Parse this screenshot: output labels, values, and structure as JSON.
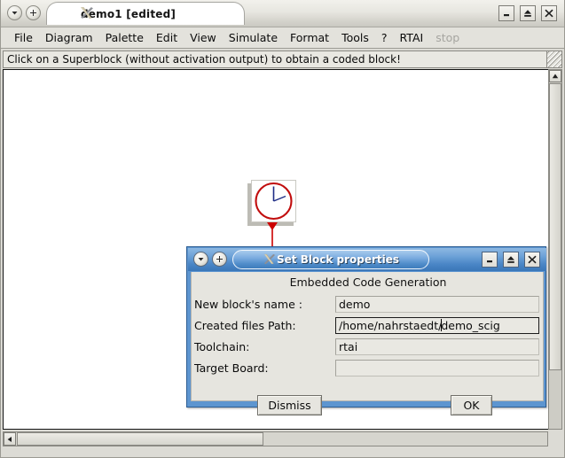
{
  "main_window": {
    "title": "demo1 [edited]",
    "app_icon": "scilab-x-icon",
    "titlebar_buttons": {
      "menu_label": "▼",
      "plus_label": "+",
      "minimize_label": "_",
      "maximize_label": "▲",
      "close_label": "✕"
    },
    "menubar": [
      {
        "label": "File",
        "disabled": false
      },
      {
        "label": "Diagram",
        "disabled": false
      },
      {
        "label": "Palette",
        "disabled": false
      },
      {
        "label": "Edit",
        "disabled": false
      },
      {
        "label": "View",
        "disabled": false
      },
      {
        "label": "Simulate",
        "disabled": false
      },
      {
        "label": "Format",
        "disabled": false
      },
      {
        "label": "Tools",
        "disabled": false
      },
      {
        "label": "?",
        "disabled": false
      },
      {
        "label": "RTAI",
        "disabled": false
      },
      {
        "label": "stop",
        "disabled": true
      }
    ],
    "hint": "Click on a Superblock (without activation output) to obtain a coded block!",
    "canvas": {
      "blocks": [
        {
          "name": "clock-block",
          "icon": "clock-icon"
        }
      ],
      "links": [
        {
          "name": "activation-link",
          "icon": "down-arrow-icon",
          "color": "#cc0000"
        }
      ]
    },
    "scrollbars": {
      "vertical_up_arrow": "▲",
      "horizontal_left_arrow": "◄"
    }
  },
  "dialog": {
    "title": "Set Block properties",
    "app_icon": "scilab-x-icon",
    "titlebar_buttons": {
      "menu_label": "▼",
      "plus_label": "+",
      "minimize_label": "_",
      "maximize_label": "▲",
      "close_label": "✕"
    },
    "heading": "Embedded Code Generation",
    "fields": [
      {
        "label": "New block's name :",
        "value": "demo",
        "focused": false
      },
      {
        "label": "Created files Path:",
        "value_before_caret": "/home/nahrstaedt/",
        "value_after_caret": "demo_scig",
        "focused": true
      },
      {
        "label": "Toolchain:",
        "value": "rtai",
        "focused": false
      },
      {
        "label": "Target Board:",
        "value": "",
        "focused": false
      }
    ],
    "buttons": {
      "dismiss": "Dismiss",
      "ok": "OK"
    }
  },
  "colors": {
    "dialog_accent": "#4a86c6",
    "window_chrome": "#e3e2dc",
    "clock_red": "#cc0000",
    "clock_hand": "#1a2a7a",
    "disabled_text": "#a6a5a0"
  }
}
